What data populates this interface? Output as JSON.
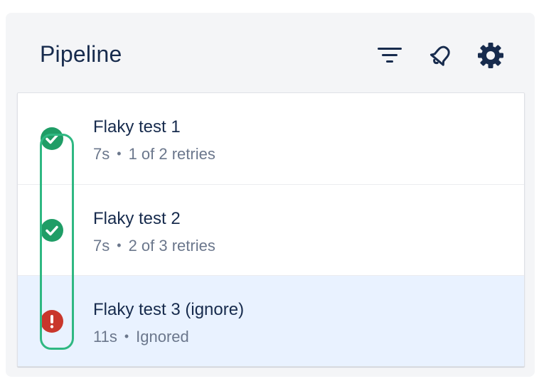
{
  "header": {
    "title": "Pipeline",
    "icons": [
      "filter-icon",
      "bell-icon",
      "gear-icon"
    ]
  },
  "colors": {
    "success": "#1f9d66",
    "error": "#c9372c",
    "highlight": "#2fb882",
    "selected_row": "#e9f2ff"
  },
  "tests": [
    {
      "title": "Flaky test 1",
      "duration": "7s",
      "detail": "1 of 2 retries",
      "status": "success"
    },
    {
      "title": "Flaky test 2",
      "duration": "7s",
      "detail": "2 of 3 retries",
      "status": "success"
    },
    {
      "title": "Flaky test 3 (ignore)",
      "duration": "11s",
      "detail": "Ignored",
      "status": "error"
    }
  ],
  "separator": "•"
}
